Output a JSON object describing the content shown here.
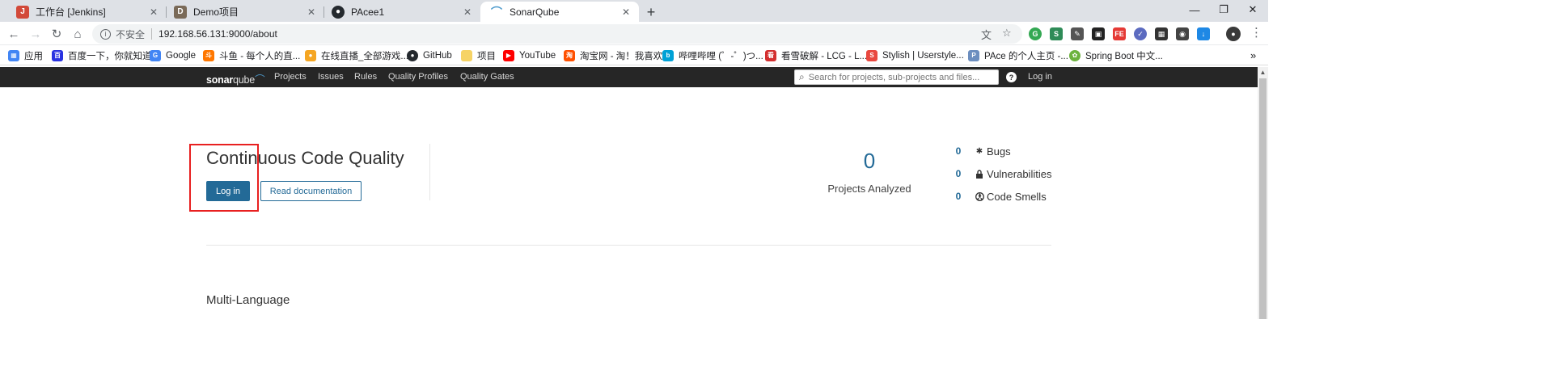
{
  "browser": {
    "tabs": [
      {
        "title": "工作台 [Jenkins]",
        "icon": "jenkins-icon",
        "color": "#d24939"
      },
      {
        "title": "Demo项目",
        "icon": "project-icon",
        "color": "#7a6a58"
      },
      {
        "title": "PAcee1",
        "icon": "github-icon",
        "color": "#24292e"
      },
      {
        "title": "SonarQube",
        "icon": "sonarqube-icon",
        "color": "#4e9bcd"
      }
    ],
    "new_tab": "+",
    "window_controls": {
      "minimize": "—",
      "restore": "❐",
      "close": "✕"
    },
    "toolbar": {
      "back": "←",
      "forward": "→",
      "reload": "↻",
      "home": "⌂",
      "insecure_label": "不安全",
      "url": "192.168.56.131:9000/about",
      "menu": "⋮"
    },
    "bookmarks": [
      {
        "label": "应用",
        "icon": "apps-icon",
        "color": "#4285f4"
      },
      {
        "label": "百度一下，你就知道",
        "icon": "baidu-icon",
        "color": "#2932e1"
      },
      {
        "label": "Google",
        "icon": "google-icon",
        "color": "#4285f4"
      },
      {
        "label": "斗鱼 - 每个人的直...",
        "icon": "douyu-icon",
        "color": "#ff7700"
      },
      {
        "label": "在线直播_全部游戏...",
        "icon": "huya-icon",
        "color": "#f5a623"
      },
      {
        "label": "GitHub",
        "icon": "github-icon",
        "color": "#24292e"
      },
      {
        "label": "项目",
        "icon": "folder-icon",
        "color": "#f6d365"
      },
      {
        "label": "YouTube",
        "icon": "youtube-icon",
        "color": "#ff0000"
      },
      {
        "label": "淘宝网 - 淘！我喜欢",
        "icon": "taobao-icon",
        "color": "#ff5000"
      },
      {
        "label": "哔哩哔哩 (゜-゜)つ...",
        "icon": "bilibili-icon",
        "color": "#00a1d6"
      },
      {
        "label": "看雪破解 - LCG - L...",
        "icon": "kanxue-icon",
        "color": "#d32f2f"
      },
      {
        "label": "Stylish | Userstyle...",
        "icon": "stylish-icon",
        "color": "#e9483f"
      },
      {
        "label": "PAce 的个人主页 -...",
        "icon": "pace-icon",
        "color": "#6c8ebf"
      },
      {
        "label": "Spring Boot 中文...",
        "icon": "spring-icon",
        "color": "#6db33f"
      }
    ],
    "bookmarks_overflow": "»"
  },
  "sonar": {
    "logo": {
      "bold": "sonar",
      "light": "qube"
    },
    "nav": [
      "Projects",
      "Issues",
      "Rules",
      "Quality Profiles",
      "Quality Gates"
    ],
    "search_placeholder": "Search for projects, sub-projects and files...",
    "help": "?",
    "login": "Log in"
  },
  "page": {
    "title": "Continuous Code Quality",
    "login_button": "Log in",
    "docs_button": "Read documentation",
    "projects_count": "0",
    "projects_label": "Projects Analyzed",
    "metrics": [
      {
        "value": "0",
        "label": "Bugs",
        "icon": "bug-icon"
      },
      {
        "value": "0",
        "label": "Vulnerabilities",
        "icon": "lock-icon"
      },
      {
        "value": "0",
        "label": "Code Smells",
        "icon": "code-smell-icon"
      }
    ],
    "section_title": "Multi-Language"
  },
  "colors": {
    "brand_blue": "#236a97",
    "nav_bg": "#262626",
    "highlight_red": "#e82020"
  }
}
